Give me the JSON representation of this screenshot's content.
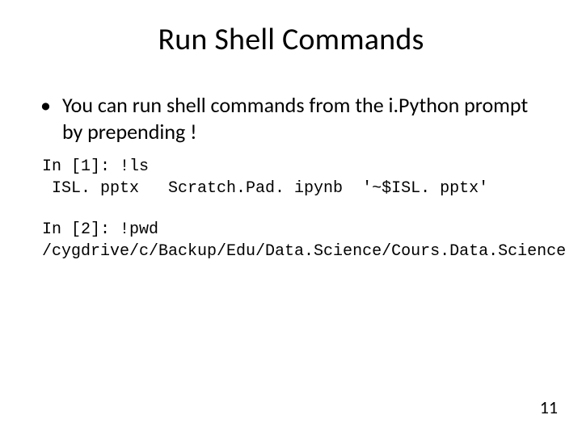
{
  "slide": {
    "title": "Run Shell Commands",
    "bullet": "You can run shell commands from the i.Python prompt by prepending  !",
    "code1_line1": "In [1]: !ls",
    "code1_line2": " ISL. pptx   Scratch.Pad. ipynb  '~$ISL. pptx'",
    "code2_line1": "In [2]: !pwd",
    "code2_line2": "/cygdrive/c/Backup/Edu/Data.Science/Cours.Data.Science",
    "page_number": "11"
  }
}
